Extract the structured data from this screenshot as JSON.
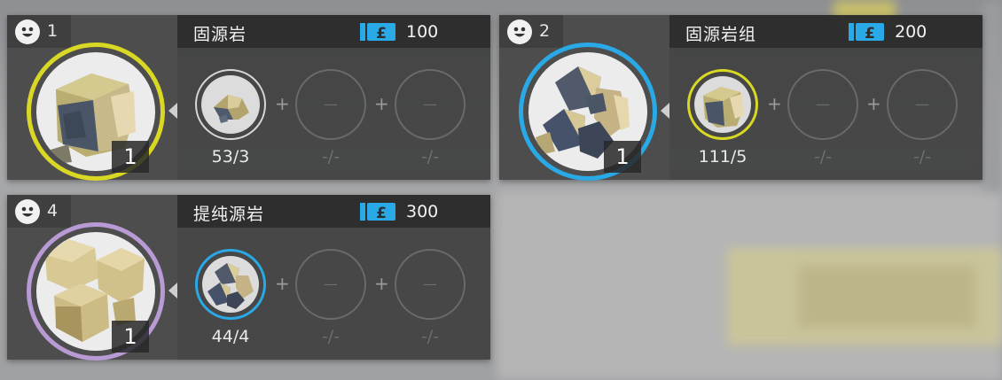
{
  "colors": {
    "ring_tier1": "#d9d925",
    "ring_tier2": "#29a9e6",
    "ring_tier4": "#b89ad4",
    "cost_icon": "#29a9e6"
  },
  "icons": [
    "smiley-icon",
    "ticket-icon"
  ],
  "cards": [
    {
      "tier": "1",
      "title": "固源岩",
      "cost": "100",
      "count": "1",
      "slots": [
        {
          "state": "filled",
          "qty": "53/3"
        },
        {
          "state": "empty",
          "dash": "—",
          "qty": "-/-"
        },
        {
          "state": "empty",
          "dash": "—",
          "qty": "-/-"
        }
      ]
    },
    {
      "tier": "2",
      "title": "固源岩组",
      "cost": "200",
      "count": "1",
      "slots": [
        {
          "state": "filled",
          "qty": "111/5"
        },
        {
          "state": "empty",
          "dash": "—",
          "qty": "-/-"
        },
        {
          "state": "empty",
          "dash": "—",
          "qty": "-/-"
        }
      ]
    },
    {
      "tier": "4",
      "title": "提纯源岩",
      "cost": "300",
      "count": "1",
      "slots": [
        {
          "state": "filled",
          "qty": "44/4"
        },
        {
          "state": "empty",
          "dash": "—",
          "qty": "-/-"
        },
        {
          "state": "empty",
          "dash": "—",
          "qty": "-/-"
        }
      ]
    }
  ],
  "plus_sign": "+"
}
